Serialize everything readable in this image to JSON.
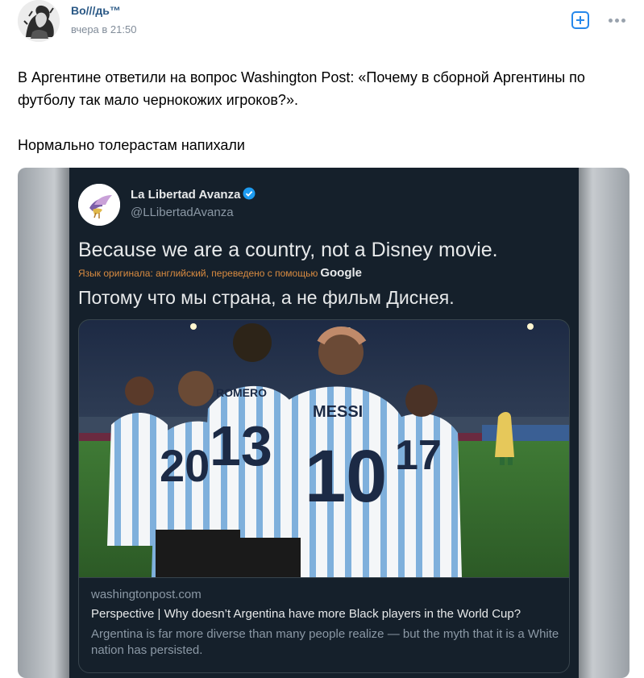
{
  "post": {
    "author": "Во///дь™",
    "time": "вчера в 21:50",
    "text_line1": "В Аргентине ответили на вопрос Washington Post: «Почему в сборной Аргентины по футболу так мало чернокожих игроков?».",
    "text_line2": "Нормально толерастам напихали"
  },
  "icons": {
    "add": "add-square-icon",
    "more": "more-horizontal-icon",
    "verified": "verified-badge-icon"
  },
  "tweet": {
    "name": "La Libertad Avanza",
    "handle": "@LLibertadAvanza",
    "text": "Because we are a country, not a Disney movie.",
    "translate_note": "Язык оригинала: английский, переведено с помощью",
    "translate_provider": "Google",
    "translated_text": "Потому что мы страна, а не фильм Диснея.",
    "card": {
      "domain": "washingtonpost.com",
      "title": "Perspective | Why doesn’t Argentina have more Black players in the World Cup?",
      "description": "Argentina is far more diverse than many people realize — but the myth that it is a White nation has persisted.",
      "jersey_name": "MESSI",
      "jersey_number": "10",
      "jersey_name_2": "ROMERO",
      "jersey_number_2": "13",
      "jersey_number_3": "17",
      "jersey_number_4": "20"
    }
  },
  "colors": {
    "link": "#2a5885",
    "accent": "#2688eb",
    "tweet_bg": "#15202b",
    "translate_note": "#d98b40"
  }
}
